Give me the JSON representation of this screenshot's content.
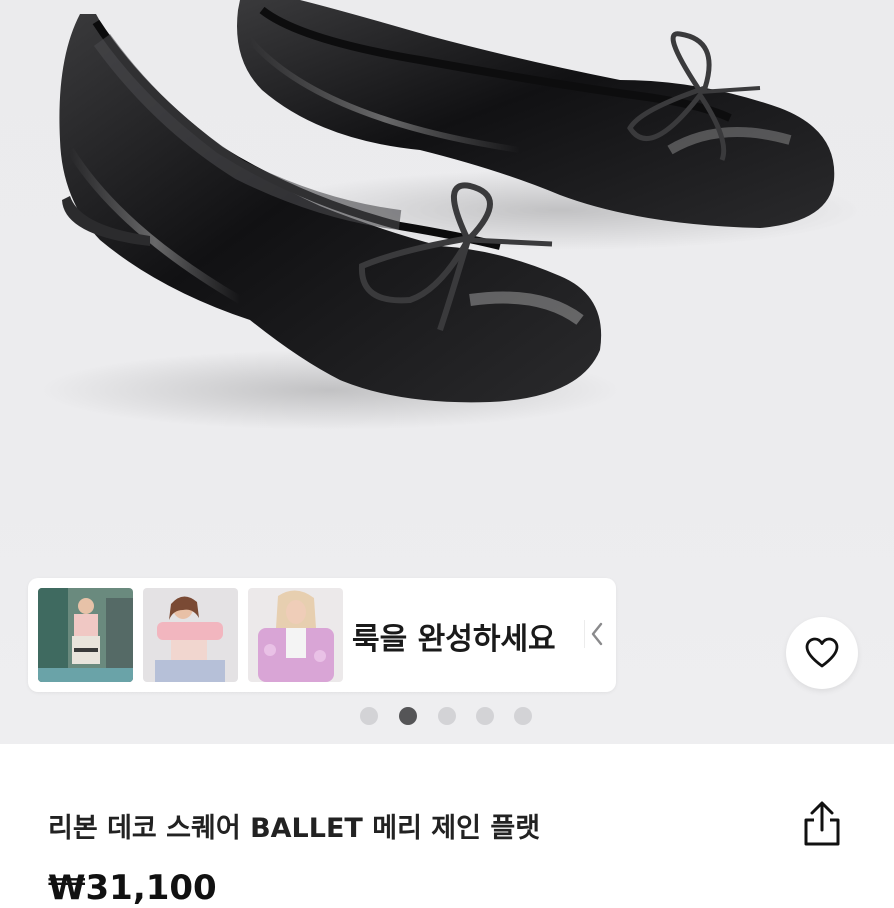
{
  "product": {
    "title": "리본 데코 스퀘어 BALLET 메리 제인 플랫",
    "price": "₩31,100"
  },
  "look_panel": {
    "label": "룩을 완성하세요",
    "thumbnails": [
      "look-thumbnail-1",
      "look-thumbnail-2",
      "look-thumbnail-3"
    ]
  },
  "carousel": {
    "page_count": 5,
    "active_index": 2
  },
  "icons": {
    "favorite": "heart-icon",
    "share": "share-icon",
    "look_panel_toggle": "chevron-left-icon"
  },
  "colors": {
    "hero_background": "#ececee",
    "dot_active": "#555557",
    "dot_inactive": "#d3d3d6",
    "text": "#222222"
  }
}
